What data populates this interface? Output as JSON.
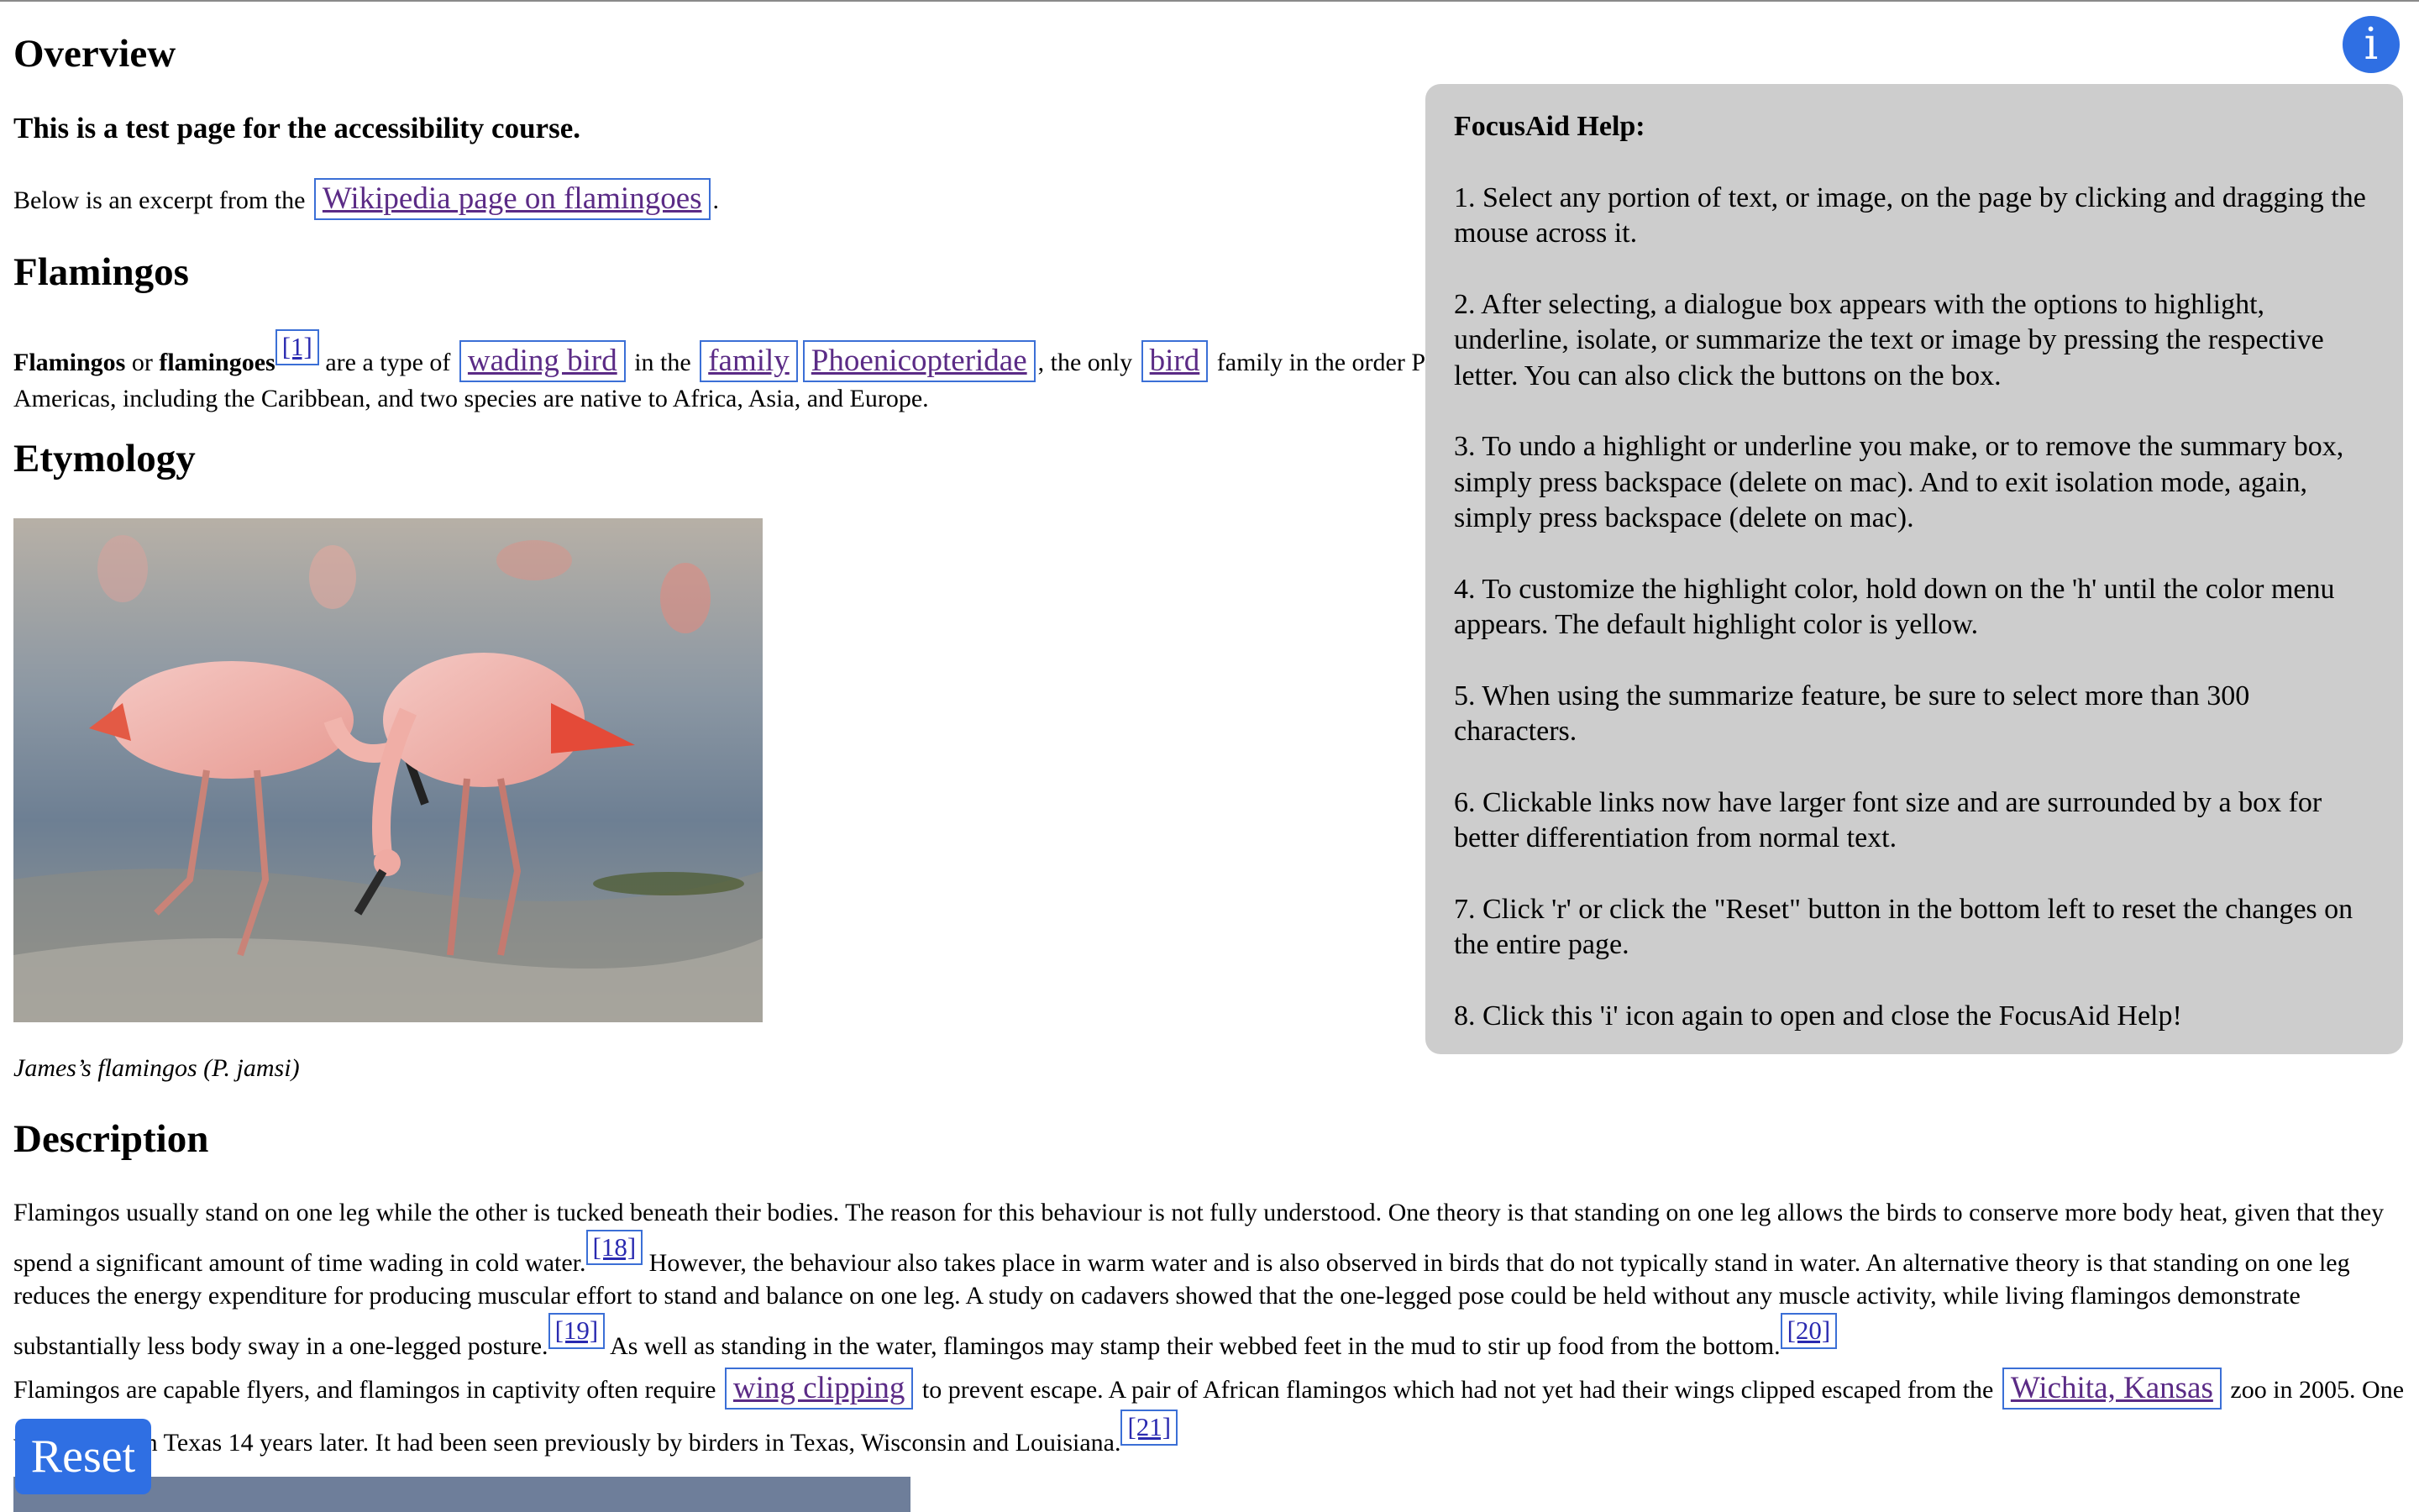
{
  "overview": {
    "heading": "Overview",
    "lead": "This is a test page for the accessibility course.",
    "intro_text": "Below is an excerpt from the",
    "intro_link": "Wikipedia page on flamingoes",
    "intro_end": "."
  },
  "flamingos": {
    "heading": "Flamingos",
    "bold1": "Flamingos",
    "or": " or ",
    "bold2": "flamingoes",
    "cite1": "[1]",
    "t1": " are a type of",
    "link_wading": "wading bird",
    "t2": "in the",
    "link_family": "family",
    "link_phoen": "Phoenicopteridae",
    "t3": ", the only",
    "link_bird": "bird",
    "t4": "family in the order Phoenicopteriformes. Four flamingo species are distributed throughout the",
    "t5": "Americas, including the Caribbean, and two species are native to Africa, Asia, and Europe."
  },
  "etymology": {
    "heading": "Etymology",
    "caption": "James’s flamingos (P. jamsi)"
  },
  "description": {
    "heading": "Description",
    "s1": "Flamingos usually stand on one leg while the other is tucked beneath their bodies. The reason for this behaviour is not fully understood. One theory is that standing on one leg allows the birds to conserve more body heat, given that they spend a significant amount of time wading in cold water.",
    "cite18": "[18]",
    "s2": " However, the behaviour also takes place in warm water and is also observed in birds that do not typically stand in water. An alternative theory is that standing on one leg reduces the energy expenditure for producing muscular effort to stand and balance on one leg. A study on cadavers showed that the one-legged pose could be held without any muscle activity, while living flamingos demonstrate substantially less body sway in a one-legged posture.",
    "cite19": "[19]",
    "s3": " As well as standing in the water, flamingos may stamp their webbed feet in the mud to stir up food from the bottom.",
    "cite20": "[20]",
    "p2a": "Flamingos are capable flyers, and flamingos in captivity often require",
    "link_wing": "wing clipping",
    "p2b": "to prevent escape. A pair of African flamingos which had not yet had their wings clipped escaped from the",
    "link_wichita": "Wichita, Kansas",
    "p2c": "zoo in 2005. One was spotted in Texas 14 years later. It had been seen previously by birders in Texas, Wisconsin and Louisiana.",
    "cite21": "[21]"
  },
  "help": {
    "title": "FocusAid Help:",
    "items": [
      "1. Select any portion of text, or image, on the page by clicking and dragging the mouse across it.",
      "2. After selecting, a dialogue box appears with the options to highlight, underline, isolate, or summarize the text or image by pressing the respective letter. You can also click the buttons on the box.",
      "3. To undo a highlight or underline you make, or to remove the summary box, simply press backspace (delete on mac). And to exit isolation mode, again, simply press backspace (delete on mac).",
      "4. To customize the highlight color, hold down on the 'h' until the color menu appears. The default highlight color is yellow.",
      "5. When using the summarize feature, be sure to select more than 300 characters.",
      "6. Clickable links now have larger font size and are surrounded by a box for better differentiation from normal text.",
      "7. Click 'r' or click the \"Reset\" button in the bottom left to reset the changes on the entire page.",
      "8. Click this 'i' icon again to open and close the FocusAid Help!"
    ]
  },
  "buttons": {
    "info": "i",
    "reset": "Reset"
  },
  "colors": {
    "accent": "#2f6fe3",
    "link": "#5b2b86",
    "link_border": "#3b6fd6",
    "panel_bg": "#cdcdcd"
  },
  "icons": {
    "info": "info-icon"
  }
}
